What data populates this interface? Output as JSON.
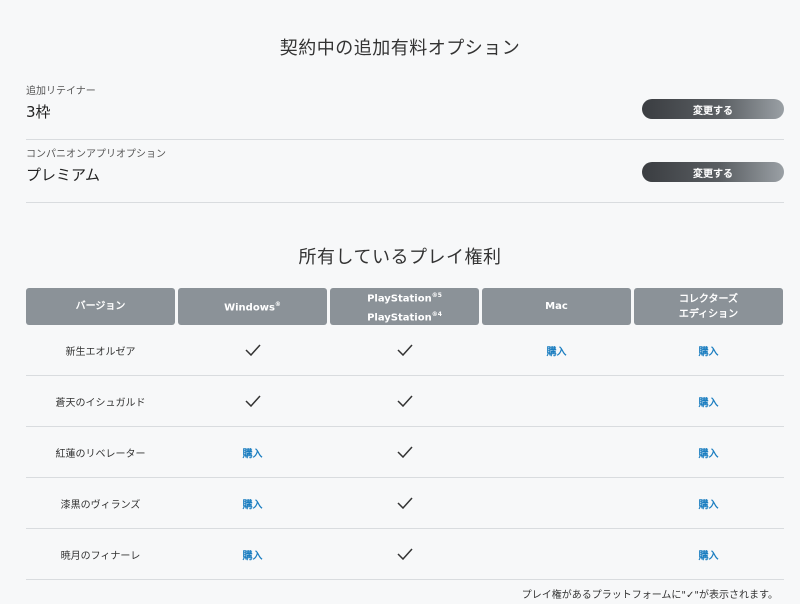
{
  "options_section": {
    "title": "契約中の追加有料オプション",
    "rows": [
      {
        "label": "追加リテイナー",
        "value": "3枠",
        "button": "変更する"
      },
      {
        "label": "コンパニオンアプリオプション",
        "value": "プレミアム",
        "button": "変更する"
      }
    ]
  },
  "rights_section": {
    "title": "所有しているプレイ権利",
    "headers": {
      "version": "バージョン",
      "windows": "Windows",
      "windows_mark": "®",
      "ps5": "PlayStation",
      "ps5_mark": "®5",
      "ps4": "PlayStation",
      "ps4_mark": "®4",
      "mac": "Mac",
      "collectors_1": "コレクターズ",
      "collectors_2": "エディション"
    },
    "buy_label": "購入",
    "rows": [
      {
        "name": "新生エオルゼア",
        "windows": "check",
        "ps": "check",
        "mac": "buy",
        "collectors": "buy"
      },
      {
        "name": "蒼天のイシュガルド",
        "windows": "check",
        "ps": "check",
        "mac": "",
        "collectors": "buy"
      },
      {
        "name": "紅蓮のリベレーター",
        "windows": "buy",
        "ps": "check",
        "mac": "",
        "collectors": "buy"
      },
      {
        "name": "漆黒のヴィランズ",
        "windows": "buy",
        "ps": "check",
        "mac": "",
        "collectors": "buy"
      },
      {
        "name": "暁月のフィナーレ",
        "windows": "buy",
        "ps": "check",
        "mac": "",
        "collectors": "buy"
      }
    ],
    "footnote": "プレイ権があるプラットフォームに\"✓\"が表示されます。"
  }
}
